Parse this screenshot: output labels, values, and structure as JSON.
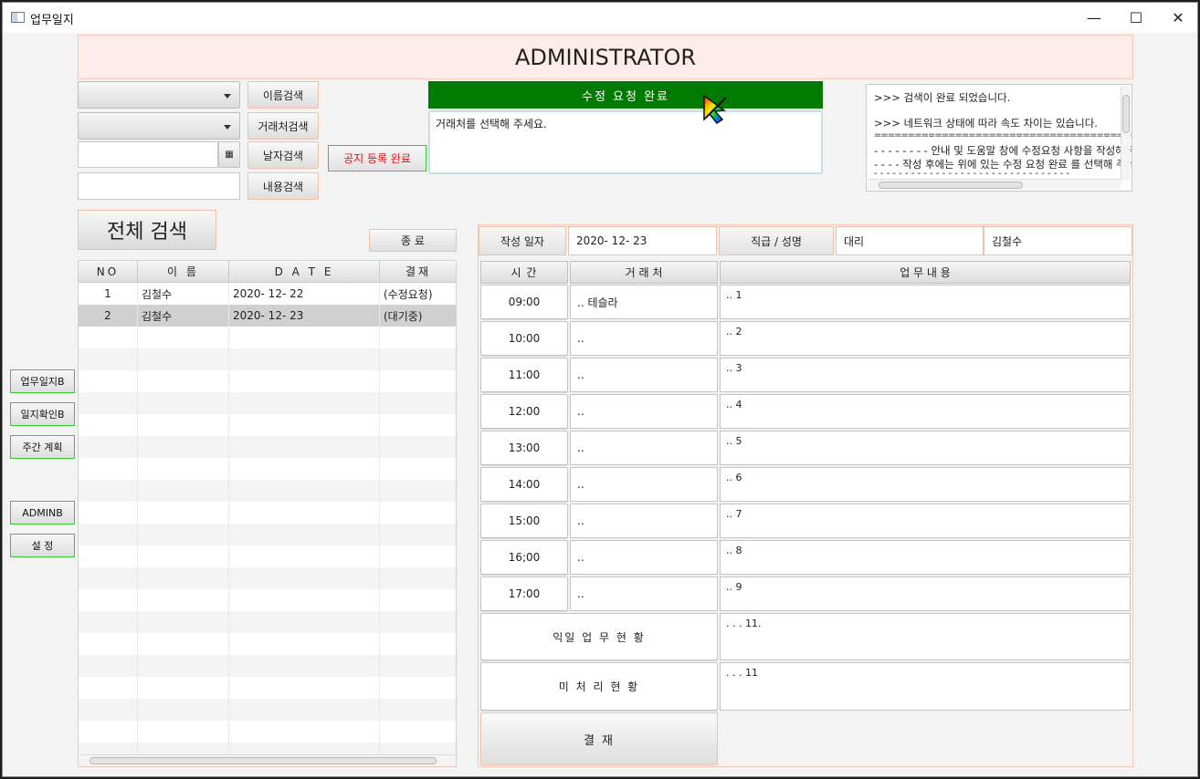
{
  "window": {
    "title": "업무일지",
    "controls": {
      "minimize": "—",
      "maximize": "☐",
      "close": "✕"
    }
  },
  "header": {
    "title": "ADMINISTRATOR"
  },
  "search": {
    "combo1_value": "",
    "combo2_value": "",
    "date_value": "",
    "content_value": "",
    "name_search_label": "이름검색",
    "client_search_label": "거래처검색",
    "date_search_label": "날자검색",
    "content_search_label": "내용검색",
    "calendar_icon": "calendar-icon"
  },
  "notice": {
    "register_label": "공지 등록 완료",
    "status_bar": "수정   요청   완료",
    "message": "거래처를 선택해 주세요."
  },
  "log": {
    "lines": [
      ">>> 검색이 완료 되었습니다.",
      "",
      ">>> 네트워크 상태에 따라 속도 차이는 있습니다.",
      "================================================",
      "- - - - - - - - 안내 및 도움말 창에 수정요청 사항을 작성해 주세요",
      "- - -  - 작성 후에는 위에 있는 수정 요청 완료 를 선택해 주세요",
      "- - - - - - - - - - - - - - - - - - - - - - - - - - - - - - - -"
    ]
  },
  "left": {
    "full_search_label": "전체 검색",
    "exit_label": "종   료",
    "table": {
      "headers": [
        "NO",
        "이  름",
        "D A T E",
        "결재"
      ],
      "rows": [
        {
          "no": "1",
          "name": "김철수",
          "date": "2020- 12- 22",
          "status": "(수정요청)"
        },
        {
          "no": "2",
          "name": "김철수",
          "date": "2020- 12- 23",
          "status": "(대기중)"
        }
      ],
      "selected_row": 2
    }
  },
  "sidebar": {
    "items": [
      {
        "label": "업무일지B"
      },
      {
        "label": "일지확인B"
      },
      {
        "label": "주간 계획"
      },
      {
        "label": "ADMINB"
      },
      {
        "label": "설   정"
      }
    ]
  },
  "report": {
    "date_label": "작성 일자",
    "date_value": "2020- 12- 23",
    "position_label": "직급 / 성명",
    "position_value": "대리",
    "name_value": "김철수",
    "col_time": "시   간",
    "col_client": "거  래  처",
    "col_work": "업        무        내        용",
    "rows": [
      {
        "time": "09:00",
        "client": ".. 테슬라",
        "work": ".. 1"
      },
      {
        "time": "10:00",
        "client": "..",
        "work": ".. 2"
      },
      {
        "time": "11:00",
        "client": "..",
        "work": ".. 3"
      },
      {
        "time": "12:00",
        "client": "..",
        "work": ".. 4"
      },
      {
        "time": "13:00",
        "client": "..",
        "work": ".. 5"
      },
      {
        "time": "14:00",
        "client": "..",
        "work": ".. 6"
      },
      {
        "time": "15:00",
        "client": "..",
        "work": ".. 7"
      },
      {
        "time": "16;00",
        "client": "..",
        "work": ".. 8"
      },
      {
        "time": "17:00",
        "client": "..",
        "work": ".. 9"
      }
    ],
    "next_day_label": "익일  업 무  현 황",
    "next_day_value": ". . . 11.",
    "pending_label": "미  처 리    현 황",
    "pending_value": ". . . 11",
    "approve_label": "결 재"
  },
  "colors": {
    "header_bg": "#fdecea",
    "status_bar": "#007a00",
    "accent_border": "#33cc33",
    "notice_text": "#e0161b"
  }
}
